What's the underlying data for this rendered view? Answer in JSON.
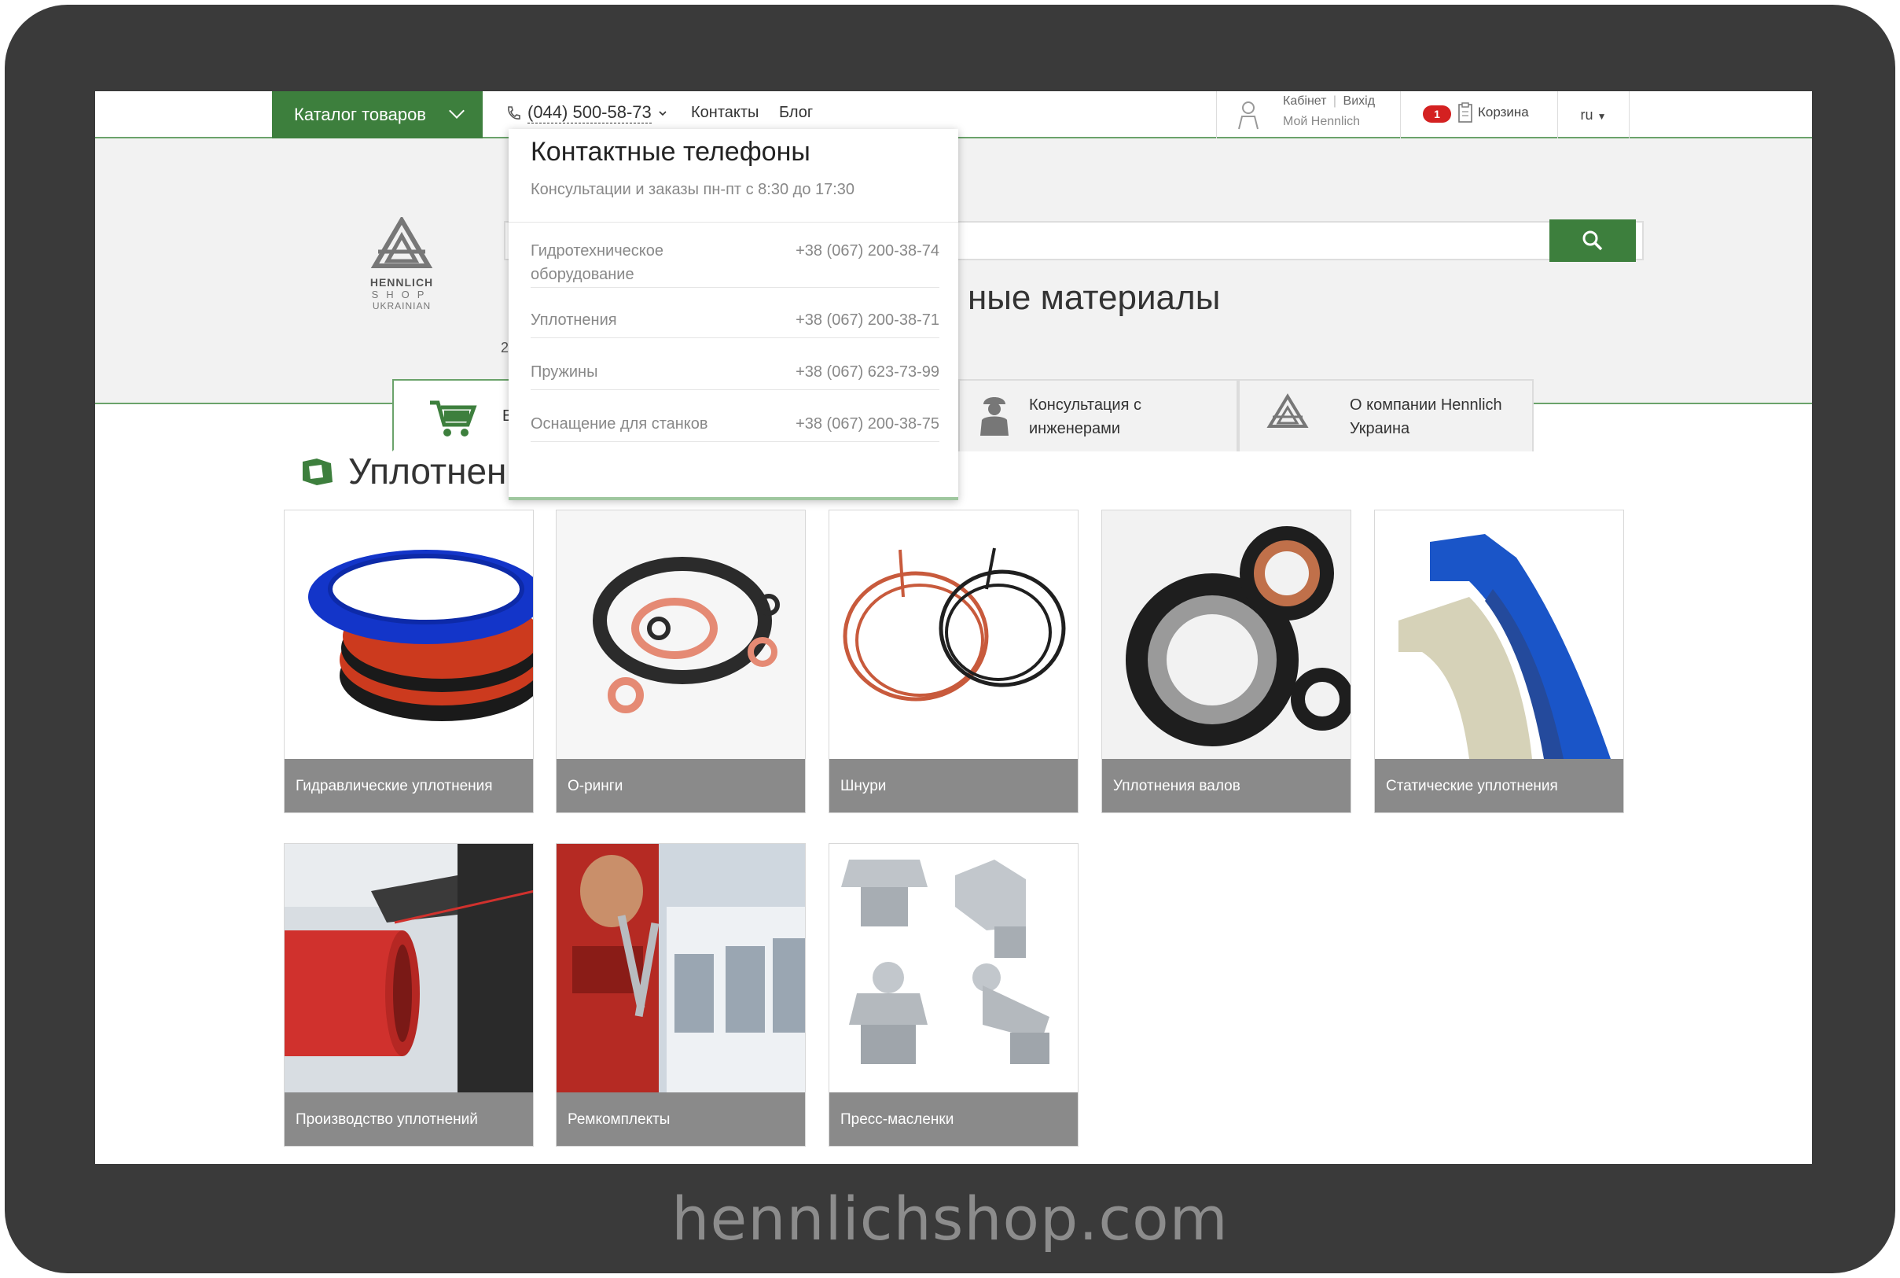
{
  "domain_text": "hennlichshop.com",
  "topbar": {
    "catalog_label": "Каталог товаров",
    "phone": "(044) 500-58-73",
    "contacts": "Контакты",
    "blog": "Блог",
    "cabinet": "Кабінет",
    "logout": "Вихід",
    "my_hennlich": "Мой Hennlich",
    "cart_count": "1",
    "cart_label": "Корзина",
    "lang": "ru"
  },
  "logo": {
    "line1": "HENNLICH",
    "line2": "SHOP",
    "line3": "UKRAINIAN"
  },
  "heading_partial": "ные материалы",
  "subline_partial": "2",
  "tabs": [
    {
      "label": "В"
    },
    {
      "label": "Консультация с инженерами"
    },
    {
      "label": "О компании Hennlich Украина"
    }
  ],
  "dropdown": {
    "title": "Контактные телефоны",
    "subtitle": "Консультации и заказы пн-пт с 8:30 до 17:30",
    "rows": [
      {
        "label": "Гидротехническое оборудование",
        "phone": "+38 (067) 200-38-74"
      },
      {
        "label": "Уплотнения",
        "phone": "+38 (067) 200-38-71"
      },
      {
        "label": "Пружины",
        "phone": "+38 (067) 623-73-99"
      },
      {
        "label": "Оснащение для станков",
        "phone": "+38 (067) 200-38-75"
      }
    ]
  },
  "section_title": "Уплотнения",
  "products": [
    {
      "name": "Гидравлические уплотнения"
    },
    {
      "name": "О-ринги"
    },
    {
      "name": "Шнури"
    },
    {
      "name": "Уплотнения валов"
    },
    {
      "name": "Статические уплотнения"
    },
    {
      "name": "Производство уплотнений"
    },
    {
      "name": "Ремкомплекты"
    },
    {
      "name": "Пресс-масленки"
    }
  ],
  "colors": {
    "brand_green": "#3d7f3d",
    "frame": "#3a3a3a",
    "caption_bg": "#8a8a8a",
    "badge_red": "#d42121"
  }
}
